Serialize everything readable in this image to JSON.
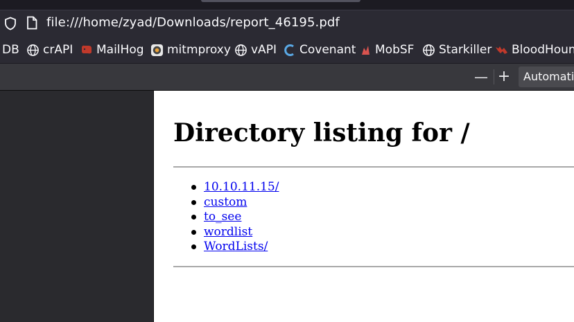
{
  "browser": {
    "url": "file:///home/zyad/Downloads/report_46195.pdf",
    "bookmarks": [
      {
        "label": "DB",
        "icon": "none"
      },
      {
        "label": "crAPI",
        "icon": "globe-icon"
      },
      {
        "label": "MailHog",
        "icon": "mailhog-icon"
      },
      {
        "label": "mitmproxy",
        "icon": "mitmproxy-icon"
      },
      {
        "label": "vAPI",
        "icon": "globe-icon"
      },
      {
        "label": "Covenant",
        "icon": "covenant-icon"
      },
      {
        "label": "MobSF",
        "icon": "mobsf-icon"
      },
      {
        "label": "Starkiller",
        "icon": "globe-icon"
      },
      {
        "label": "BloodHound",
        "icon": "bloodhound-icon"
      }
    ]
  },
  "pdf_toolbar": {
    "zoom_out": "—",
    "zoom_in": "+",
    "zoom_value": "Automatic Zoom"
  },
  "document": {
    "title": "Directory listing for /",
    "entries": [
      "10.10.11.15/",
      "custom",
      "to_see",
      "wordlist",
      "WordLists/"
    ]
  },
  "colors": {
    "chrome_dark": "#1c1b22",
    "toolbar": "#2b2a33",
    "pdf_toolbar": "#38383d",
    "sidebar": "#2a2a2e",
    "link": "#0000ee"
  }
}
